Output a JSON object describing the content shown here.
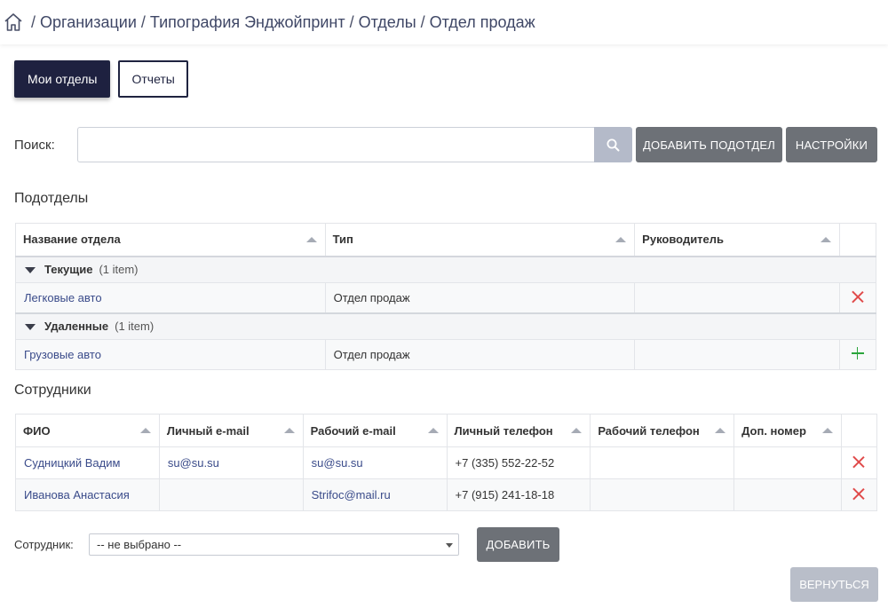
{
  "breadcrumb": {
    "separator": "/",
    "items": [
      "Организации",
      "Типография Энджойпринт",
      "Отделы",
      "Отдел продаж"
    ]
  },
  "tabs": [
    {
      "label": "Мои отделы",
      "active": true
    },
    {
      "label": "Отчеты",
      "active": false
    }
  ],
  "search": {
    "label": "Поиск:",
    "value": "",
    "placeholder": ""
  },
  "toolbar": {
    "add_subdepartment_label": "ДОБАВИТЬ ПОДОТДЕЛ",
    "settings_label": "НАСТРОЙКИ"
  },
  "subdepartments": {
    "title": "Подотделы",
    "columns": [
      "Название отдела",
      "Тип",
      "Руководитель"
    ],
    "groups": [
      {
        "name": "Текущие",
        "count": "(1 item)",
        "rows": [
          {
            "name": "Легковые авто",
            "type": "Отдел продаж",
            "head": "",
            "action": "delete"
          }
        ]
      },
      {
        "name": "Удаленные",
        "count": "(1 item)",
        "rows": [
          {
            "name": "Грузовые авто",
            "type": "Отдел продаж",
            "head": "",
            "action": "restore"
          }
        ]
      }
    ]
  },
  "employees": {
    "title": "Сотрудники",
    "columns": [
      "ФИО",
      "Личный e-mail",
      "Рабочий e-mail",
      "Личный телефон",
      "Рабочий телефон",
      "Доп. номер"
    ],
    "rows": [
      {
        "name": "Судницкий Вадим",
        "personal_email": "su@su.su",
        "work_email": "su@su.su",
        "personal_phone": "+7 (335) 552-22-52",
        "work_phone": "",
        "ext": ""
      },
      {
        "name": "Иванова Анастасия",
        "personal_email": "",
        "work_email": "Strifoc@mail.ru",
        "personal_phone": "+7 (915) 241-18-18",
        "work_phone": "",
        "ext": ""
      }
    ]
  },
  "employee_picker": {
    "label": "Сотрудник:",
    "selected": "-- не выбрано --",
    "add_label": "ДОБАВИТЬ"
  },
  "back_label": "ВЕРНУТЬСЯ",
  "colors": {
    "primary_dark": "#1e2140",
    "button_gray": "#6d7177",
    "link": "#3a4b8a",
    "delete": "#e04a4a",
    "restore": "#2aa53b",
    "disabled": "#b9bec9"
  }
}
